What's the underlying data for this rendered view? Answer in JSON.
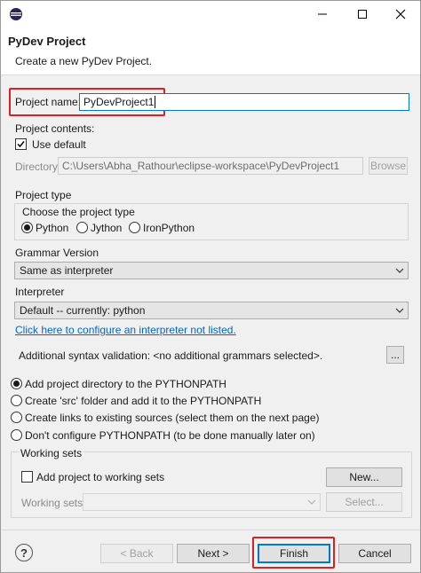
{
  "header": {
    "title": "PyDev Project",
    "subtitle": "Create a new PyDev Project."
  },
  "project_name": {
    "label": "Project name:",
    "value": "PyDevProject1"
  },
  "project_contents": {
    "label": "Project contents:",
    "use_default": "Use default",
    "directory_label": "Directory",
    "directory_value": "C:\\Users\\Abha_Rathour\\eclipse-workspace\\PyDevProject1",
    "browse": "Browse"
  },
  "project_type": {
    "label": "Project type",
    "choose": "Choose the project type",
    "options": [
      "Python",
      "Jython",
      "IronPython"
    ]
  },
  "grammar": {
    "label": "Grammar Version",
    "value": "Same as interpreter"
  },
  "interpreter": {
    "label": "Interpreter",
    "value": "Default  --  currently: python",
    "config_link": "Click here to configure an interpreter not listed."
  },
  "syntax": {
    "text": "Additional syntax validation: <no additional grammars selected>.",
    "more": "..."
  },
  "pythonpath": {
    "options": [
      "Add project directory to the PYTHONPATH",
      "Create 'src' folder and add it to the PYTHONPATH",
      "Create links to existing sources (select them on the next page)",
      "Don't configure PYTHONPATH (to be done manually later on)"
    ]
  },
  "working_sets": {
    "label": "Working sets",
    "add_label": "Add project to working sets",
    "new": "New...",
    "sets_label": "Working sets:",
    "select": "Select..."
  },
  "footer": {
    "help": "?",
    "back": "< Back",
    "next": "Next >",
    "finish": "Finish",
    "cancel": "Cancel"
  },
  "colors": {
    "highlight": "#e02020",
    "link": "#0066cc",
    "focus": "#0078d7"
  }
}
